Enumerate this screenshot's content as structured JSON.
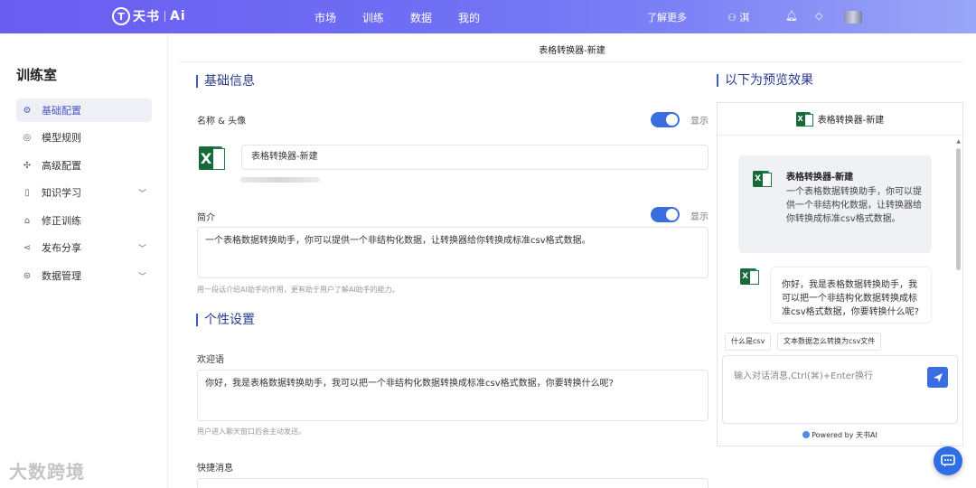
{
  "header": {
    "brand": "天书",
    "brand_ai": "Ai",
    "nav": [
      "市场",
      "训练",
      "数据",
      "我的"
    ],
    "learn_more": "了解更多",
    "user": "淇"
  },
  "sidebar": {
    "title": "训练室",
    "items": [
      {
        "label": "基础配置",
        "icon": "gear-icon",
        "active": true
      },
      {
        "label": "模型规则",
        "icon": "target-icon"
      },
      {
        "label": "高级配置",
        "icon": "puzzle-icon"
      },
      {
        "label": "知识学习",
        "icon": "book-icon",
        "expandable": true
      },
      {
        "label": "修正训练",
        "icon": "robot-icon"
      },
      {
        "label": "发布分享",
        "icon": "share-icon",
        "expandable": true
      },
      {
        "label": "数据管理",
        "icon": "database-icon",
        "expandable": true
      }
    ]
  },
  "page": {
    "title": "表格转换器-新建"
  },
  "basic": {
    "section_title": "基础信息",
    "name_label": "名称 & 头像",
    "show_label": "显示",
    "name_value": "表格转换器-新建",
    "intro_label": "简介",
    "intro_value": "一个表格数据转换助手，你可以提供一个非结构化数据，让转换器给你转换成标准csv格式数据。",
    "intro_hint": "用一段话介绍AI助手的作用，更有助于用户了解AI助手的能力。"
  },
  "personal": {
    "section_title": "个性设置",
    "welcome_label": "欢迎语",
    "welcome_value": "你好，我是表格数据转换助手，我可以把一个非结构化数据转换成标准csv格式数据，你要转换什么呢?",
    "welcome_hint": "用户进入聊天窗口后会主动发送。",
    "quick_label": "快捷消息"
  },
  "preview": {
    "section_title": "以下为预览效果",
    "bot_name": "表格转换器-新建",
    "card_desc": "一个表格数据转换助手，你可以提供一个非结构化数据，让转换器给你转换成标准csv格式数据。",
    "welcome_msg": "你好，我是表格数据转换助手，我可以把一个非结构化数据转换成标准csv格式数据，你要转换什么呢?",
    "chips": [
      "什么是csv",
      "文本数据怎么转换为csv文件"
    ],
    "input_placeholder": "输入对话消息,Ctrl(⌘)+Enter换行",
    "powered": "Powered by 天书AI"
  },
  "watermark": "大数跨境",
  "colors": {
    "accent": "#3a6ee0",
    "header_start": "#6a5cf0",
    "header_end": "#9aa6f7",
    "excel": "#1f7a45"
  }
}
